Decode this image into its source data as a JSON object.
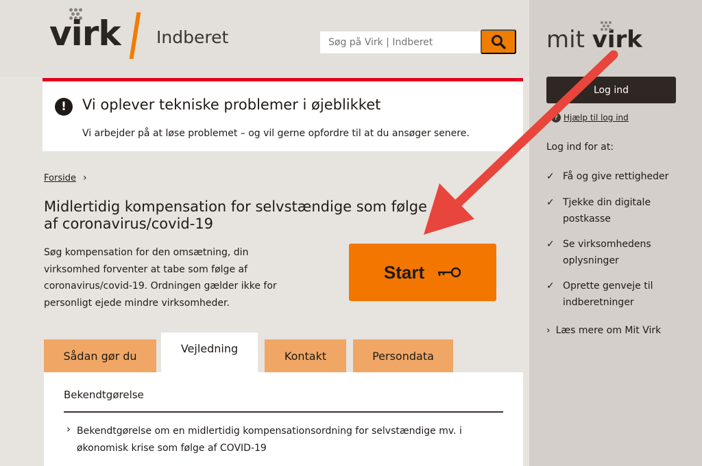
{
  "header": {
    "logo_text": "virk",
    "product": "Indberet",
    "search_placeholder": "Søg på Virk | Indberet"
  },
  "alert": {
    "icon": "!",
    "title": "Vi oplever tekniske problemer i øjeblikket",
    "text": "Vi arbejder på at løse problemet – og vil gerne opfordre til at du ansøger senere."
  },
  "breadcrumb": {
    "home": "Forside"
  },
  "page": {
    "title": "Midlertidig kompensation for selvstændige som følge af coronavirus/covid-19",
    "intro": "Søg kompensation for den omsætning, din virksomhed forventer at tabe som følge af coronavirus/covid-19. Ordningen gælder ikke for personligt ejede mindre virksomheder.",
    "start_label": "Start"
  },
  "tabs": [
    {
      "label": "Sådan gør du"
    },
    {
      "label": "Vejledning",
      "active": true
    },
    {
      "label": "Kontakt"
    },
    {
      "label": "Persondata"
    }
  ],
  "panel": {
    "heading": "Bekendtgørelse",
    "link": "Bekendtgørelse om en midlertidig kompensationsordning for selvstændige mv. i økonomisk krise som følge af COVID-19"
  },
  "side": {
    "brand_light": "mit",
    "brand_bold": "virk",
    "login_label": "Log ind",
    "help_label": "Hjælp til log ind",
    "lead": "Log ind for at:",
    "benefits": [
      "Få og give rettigheder",
      "Tjekke din digitale postkasse",
      "Se virksomhedens oplysninger",
      "Oprette genveje til indberetninger"
    ],
    "read_more": "Læs mere om Mit Virk"
  },
  "colors": {
    "accent": "#f07d00",
    "alert_border": "#e2001a",
    "annotation_arrow": "#e8453c"
  }
}
